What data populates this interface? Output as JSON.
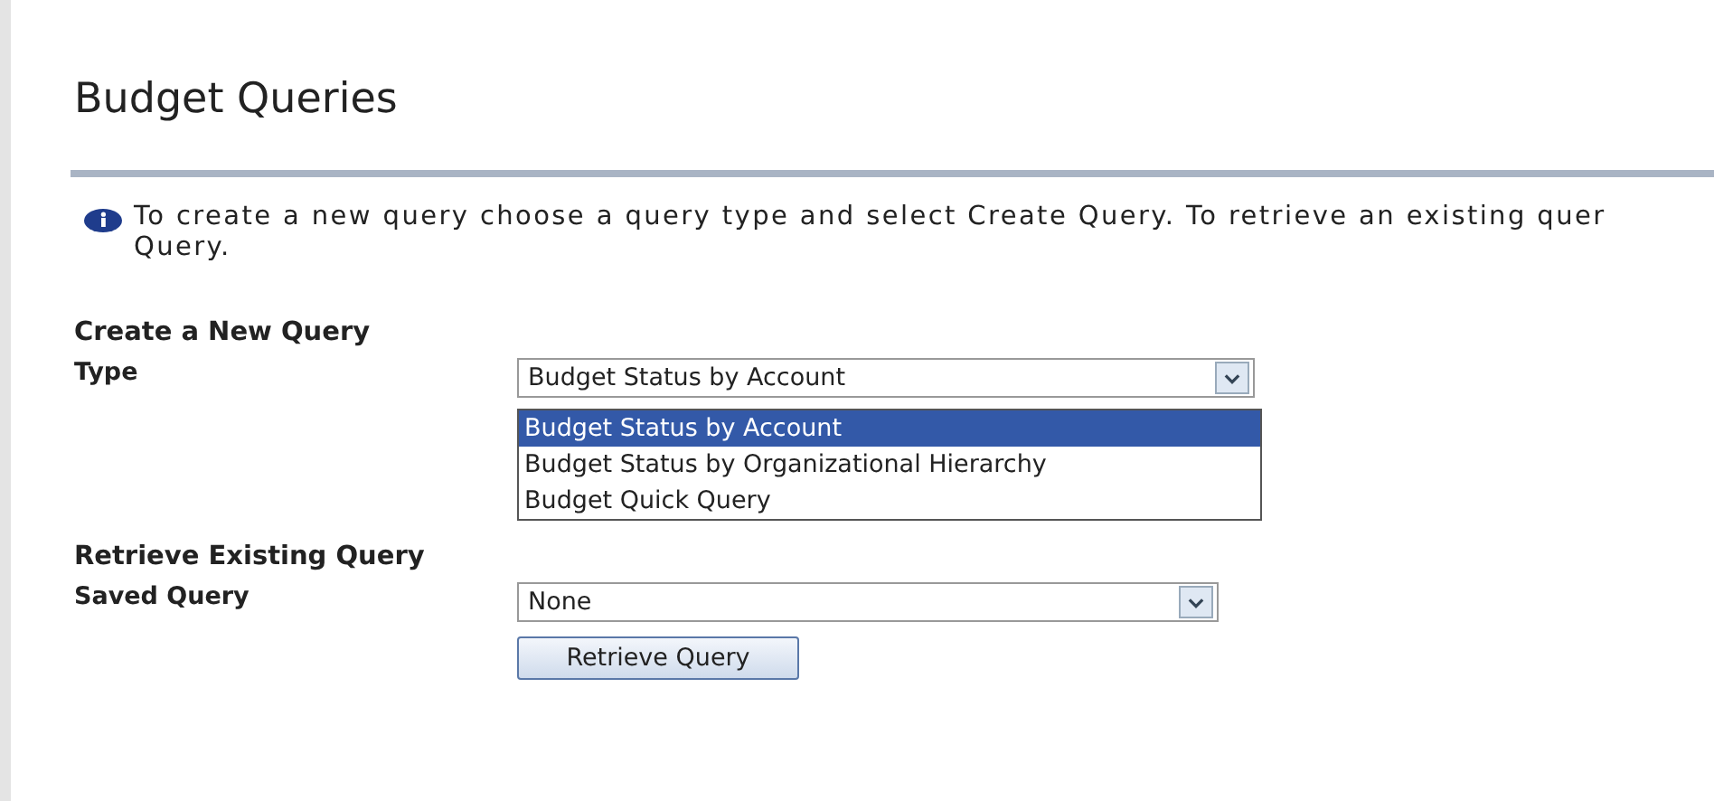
{
  "page": {
    "title": "Budget Queries"
  },
  "info": {
    "line_1": "To create a new query choose a query type and select Create Query. To retrieve an existing quer",
    "line_2": "Query."
  },
  "create": {
    "heading": "Create a New Query",
    "label": "Type",
    "value": "Budget Status by Account",
    "expanded": true,
    "options": [
      {
        "label": "Budget Status by Account",
        "selected": true
      },
      {
        "label": "Budget Status by Organizational Hierarchy",
        "selected": false
      },
      {
        "label": "Budget Quick Query",
        "selected": false
      }
    ]
  },
  "retrieve": {
    "heading": "Retrieve Existing Query",
    "label": "Saved Query",
    "value": "None",
    "button": "Retrieve Query"
  }
}
